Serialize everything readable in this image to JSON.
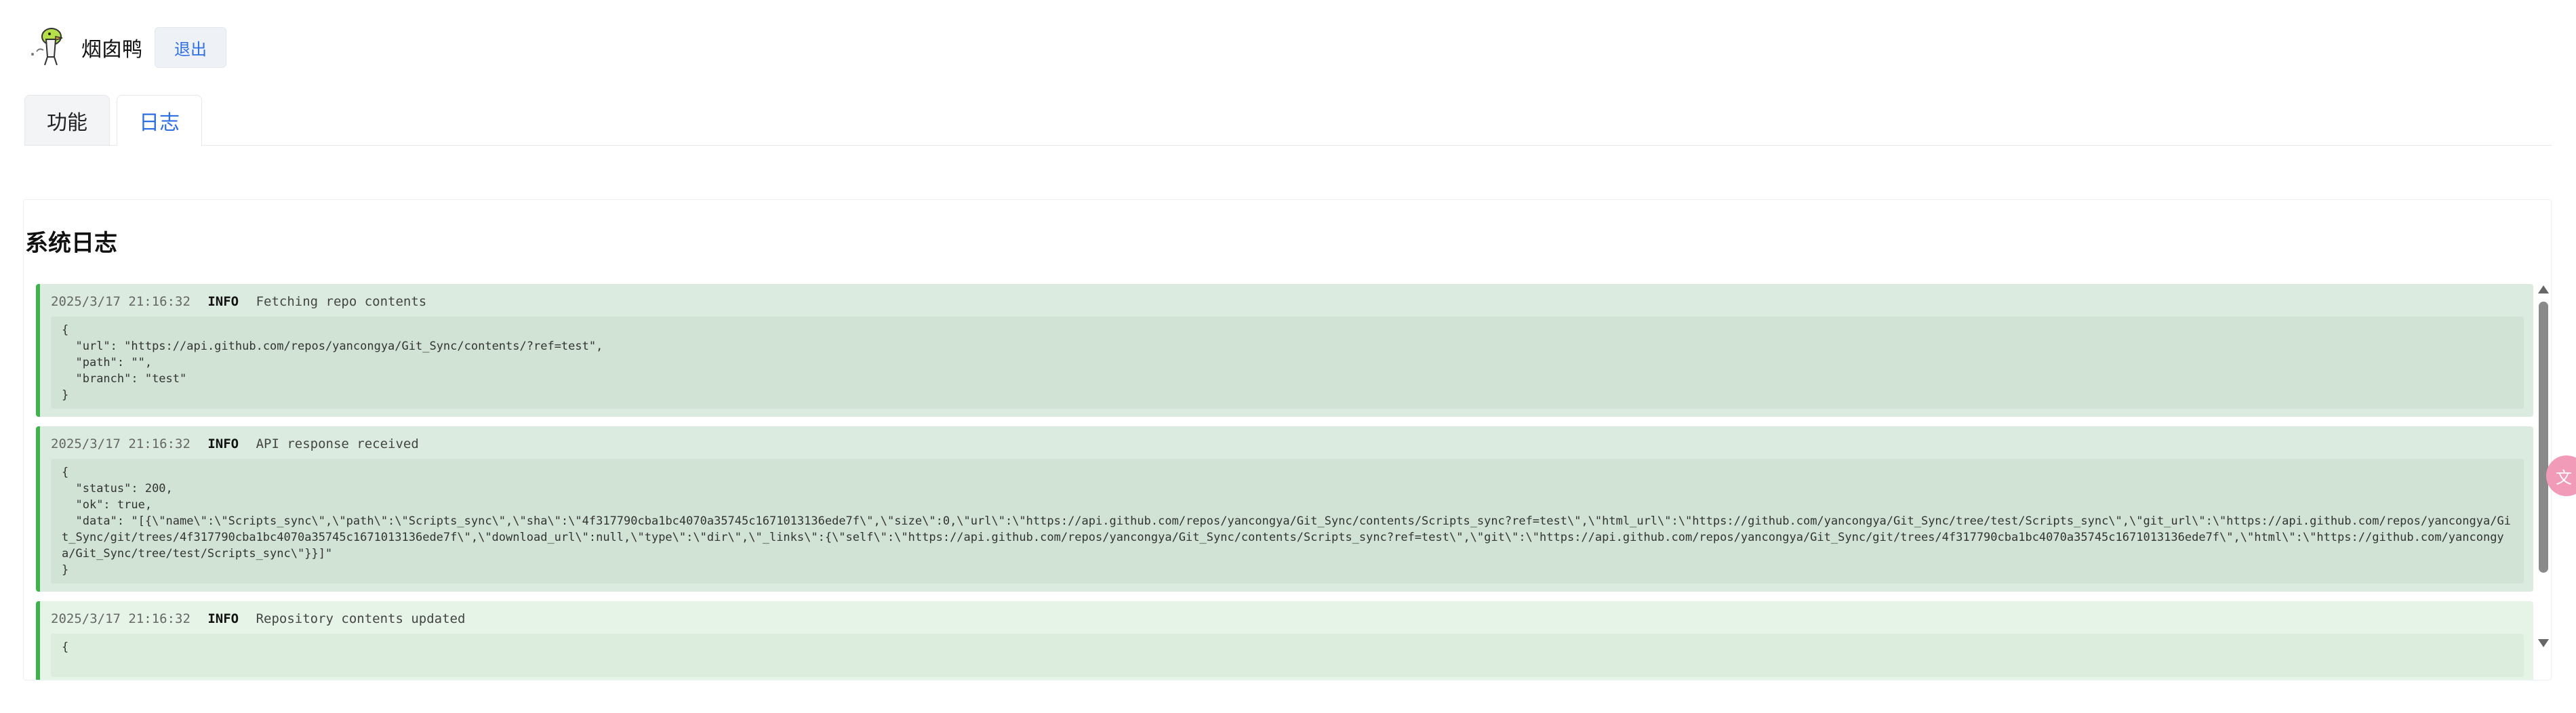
{
  "header": {
    "username": "烟囱鸭",
    "logout_label": "退出",
    "avatar_icon": "duck-avatar-icon"
  },
  "tabs": [
    {
      "label": "功能",
      "active": false
    },
    {
      "label": "日志",
      "active": true
    }
  ],
  "panel": {
    "title": "系统日志"
  },
  "logs": [
    {
      "time": "2025/3/17 21:16:32",
      "level": "INFO",
      "message": "Fetching repo contents",
      "body": "{\n  \"url\": \"https://api.github.com/repos/yancongya/Git_Sync/contents/?ref=test\",\n  \"path\": \"\",\n  \"branch\": \"test\"\n}"
    },
    {
      "time": "2025/3/17 21:16:32",
      "level": "INFO",
      "message": "API response received",
      "body": "{\n  \"status\": 200,\n  \"ok\": true,\n  \"data\": \"[{\\\"name\\\":\\\"Scripts_sync\\\",\\\"path\\\":\\\"Scripts_sync\\\",\\\"sha\\\":\\\"4f317790cba1bc4070a35745c1671013136ede7f\\\",\\\"size\\\":0,\\\"url\\\":\\\"https://api.github.com/repos/yancongya/Git_Sync/contents/Scripts_sync?ref=test\\\",\\\"html_url\\\":\\\"https://github.com/yancongya/Git_Sync/tree/test/Scripts_sync\\\",\\\"git_url\\\":\\\"https://api.github.com/repos/yancongya/Git_Sync/git/trees/4f317790cba1bc4070a35745c1671013136ede7f\\\",\\\"download_url\\\":null,\\\"type\\\":\\\"dir\\\",\\\"_links\\\":{\\\"self\\\":\\\"https://api.github.com/repos/yancongya/Git_Sync/contents/Scripts_sync?ref=test\\\",\\\"git\\\":\\\"https://api.github.com/repos/yancongya/Git_Sync/git/trees/4f317790cba1bc4070a35745c1671013136ede7f\\\",\\\"html\\\":\\\"https://github.com/yancongya/Git_Sync/tree/test/Scripts_sync\\\"}}]\"\n}"
    },
    {
      "time": "2025/3/17 21:16:32",
      "level": "INFO",
      "message": "Repository contents updated",
      "body": "{\n  "
    }
  ],
  "colors": {
    "accent": "#2f6fe4",
    "log_border": "#3cb44b",
    "log_bg": "#dcebdf"
  }
}
